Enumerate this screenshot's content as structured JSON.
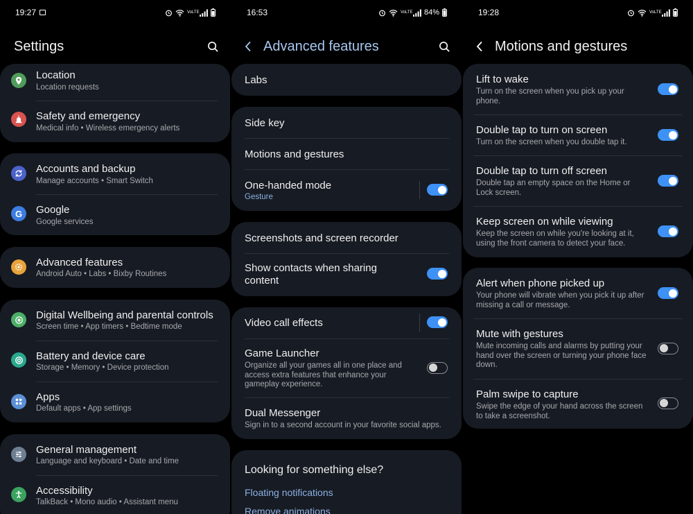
{
  "screens": [
    {
      "status": {
        "time": "19:27",
        "icons": [
          "gallery-icon",
          "alarm-icon",
          "wifi-icon",
          "volte-icon",
          "signal-icon",
          "battery-icon"
        ],
        "volte": "VoLTE"
      },
      "header": {
        "title": "Settings"
      },
      "groups": [
        {
          "items": [
            {
              "title": "Location",
              "subtitle": "Location requests",
              "icon": "location-icon",
              "color": "#4f9c5b"
            },
            {
              "title": "Safety and emergency",
              "subtitle": "Medical info  •  Wireless emergency alerts",
              "icon": "emergency-icon",
              "color": "#d9534f"
            }
          ]
        },
        {
          "items": [
            {
              "title": "Accounts and backup",
              "subtitle": "Manage accounts  •  Smart Switch",
              "icon": "sync-icon",
              "color": "#4b62c9"
            },
            {
              "title": "Google",
              "subtitle": "Google services",
              "icon": "google-icon",
              "color": "#3d7de0"
            }
          ]
        },
        {
          "items": [
            {
              "title": "Advanced features",
              "subtitle": "Android Auto  •  Labs  •  Bixby Routines",
              "icon": "star-gear-icon",
              "color": "#e8a33a"
            }
          ]
        },
        {
          "items": [
            {
              "title": "Digital Wellbeing and parental controls",
              "subtitle": "Screen time  •  App timers  •  Bedtime mode",
              "icon": "wellbeing-icon",
              "color": "#4caf68"
            },
            {
              "title": "Battery and device care",
              "subtitle": "Storage  •  Memory  •  Device protection",
              "icon": "device-care-icon",
              "color": "#2aa88e"
            },
            {
              "title": "Apps",
              "subtitle": "Default apps  •  App settings",
              "icon": "apps-icon",
              "color": "#5b8fd6"
            }
          ]
        },
        {
          "items": [
            {
              "title": "General management",
              "subtitle": "Language and keyboard  •  Date and time",
              "icon": "sliders-icon",
              "color": "#6e7f93"
            },
            {
              "title": "Accessibility",
              "subtitle": "TalkBack  •  Mono audio  •  Assistant menu",
              "icon": "accessibility-icon",
              "color": "#3aa35f"
            }
          ]
        }
      ]
    },
    {
      "status": {
        "time": "16:53",
        "volte": "VoLTE",
        "battery": "84%"
      },
      "header": {
        "title": "Advanced features"
      },
      "groups": [
        {
          "items": [
            {
              "title": "Labs"
            }
          ]
        },
        {
          "items": [
            {
              "title": "Side key"
            },
            {
              "title": "Motions and gestures"
            },
            {
              "title": "One-handed mode",
              "subtitle": "Gesture",
              "toggle": true
            }
          ]
        },
        {
          "items": [
            {
              "title": "Screenshots and screen recorder"
            },
            {
              "title": "Show contacts when sharing content",
              "toggle": true
            }
          ]
        },
        {
          "items": [
            {
              "title": "Video call effects",
              "toggle": true
            },
            {
              "title": "Game Launcher",
              "subtitle": "Organize all your games all in one place and access extra features that enhance your gameplay experience.",
              "toggle": false
            },
            {
              "title": "Dual Messenger",
              "subtitle": "Sign in to a second account in your favorite social apps."
            }
          ]
        }
      ],
      "footer": {
        "title": "Looking for something else?",
        "links": [
          "Floating notifications",
          "Remove animations"
        ]
      }
    },
    {
      "status": {
        "time": "19:28",
        "volte": "VoLTE"
      },
      "header": {
        "title": "Motions and gestures"
      },
      "groups": [
        {
          "items": [
            {
              "title": "Lift to wake",
              "subtitle": "Turn on the screen when you pick up your phone.",
              "toggle": true
            },
            {
              "title": "Double tap to turn on screen",
              "subtitle": "Turn on the screen when you double tap it.",
              "toggle": true
            },
            {
              "title": "Double tap to turn off screen",
              "subtitle": "Double tap an empty space on the Home or Lock screen.",
              "toggle": true
            },
            {
              "title": "Keep screen on while viewing",
              "subtitle": "Keep the screen on while you're looking at it, using the front camera to detect your face.",
              "toggle": true
            }
          ]
        },
        {
          "items": [
            {
              "title": "Alert when phone picked up",
              "subtitle": "Your phone will vibrate when you pick it up after missing a call or message.",
              "toggle": true
            },
            {
              "title": "Mute with gestures",
              "subtitle": "Mute incoming calls and alarms by putting your hand over the screen or turning your phone face down.",
              "toggle": false
            },
            {
              "title": "Palm swipe to capture",
              "subtitle": "Swipe the edge of your hand across the screen to take a screenshot.",
              "toggle": false
            }
          ]
        }
      ]
    }
  ]
}
